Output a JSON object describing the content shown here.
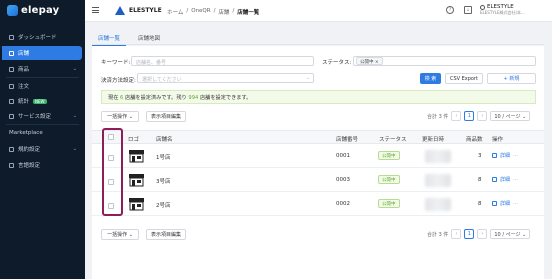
{
  "sidebar": {
    "logo": "elepay",
    "items": [
      {
        "label": "ダッシュボード"
      },
      {
        "label": "店舗"
      },
      {
        "label": "商品"
      },
      {
        "label": "注文"
      },
      {
        "label": "統計",
        "badge": "NEW"
      },
      {
        "label": "サービス設定"
      },
      {
        "label": "Marketplace"
      },
      {
        "label": "規約設定"
      },
      {
        "label": "言語設定"
      }
    ]
  },
  "header": {
    "brand": "ELESTYLE",
    "breadcrumb": [
      "ホーム",
      "OneQR",
      "店舗",
      "店舗一覧"
    ],
    "user_name": "ELESTYLE",
    "user_sub": "ELESTYLE株式会社(本..."
  },
  "tabs": [
    "店舗一覧",
    "店舗地図"
  ],
  "filters": {
    "keyword_label": "キーワード:",
    "keyword_placeholder": "店舗名、番号",
    "status_label": "ステータス:",
    "status_chip": "公開中 ×",
    "settle_label": "決済方法設定:",
    "settle_placeholder": "選択してください",
    "search_button": "検 索",
    "csv_button": "CSV Export",
    "new_button": "+ 新規"
  },
  "notice": {
    "prefix": "現在",
    "current": "6",
    "middle": "店舗を設定済みです。残り",
    "remaining": "994",
    "suffix": "店舗を設定できます。"
  },
  "toolbar": {
    "bulk": "一括操作 ⌄",
    "columns": "表示項目編集",
    "total": "合計 3 件",
    "page": "1",
    "page_size": "10 / ページ ⌄"
  },
  "table": {
    "headers": [
      "ロゴ",
      "店舗名",
      "店舗番号",
      "ステータス",
      "更新日時",
      "商品数",
      "操作"
    ],
    "rows": [
      {
        "name": "1号店",
        "number": "0001",
        "status": "公開中",
        "products": "3"
      },
      {
        "name": "3号店",
        "number": "0003",
        "status": "公開中",
        "products": "8"
      },
      {
        "name": "2号店",
        "number": "0002",
        "status": "公開中",
        "products": "8"
      }
    ],
    "action_label": "詳細",
    "more_label": "···"
  },
  "colors": {
    "accent": "#2d7be3",
    "sidebar": "#0d1b2a",
    "success": "#5aab2f",
    "highlight": "#8e1e57"
  }
}
